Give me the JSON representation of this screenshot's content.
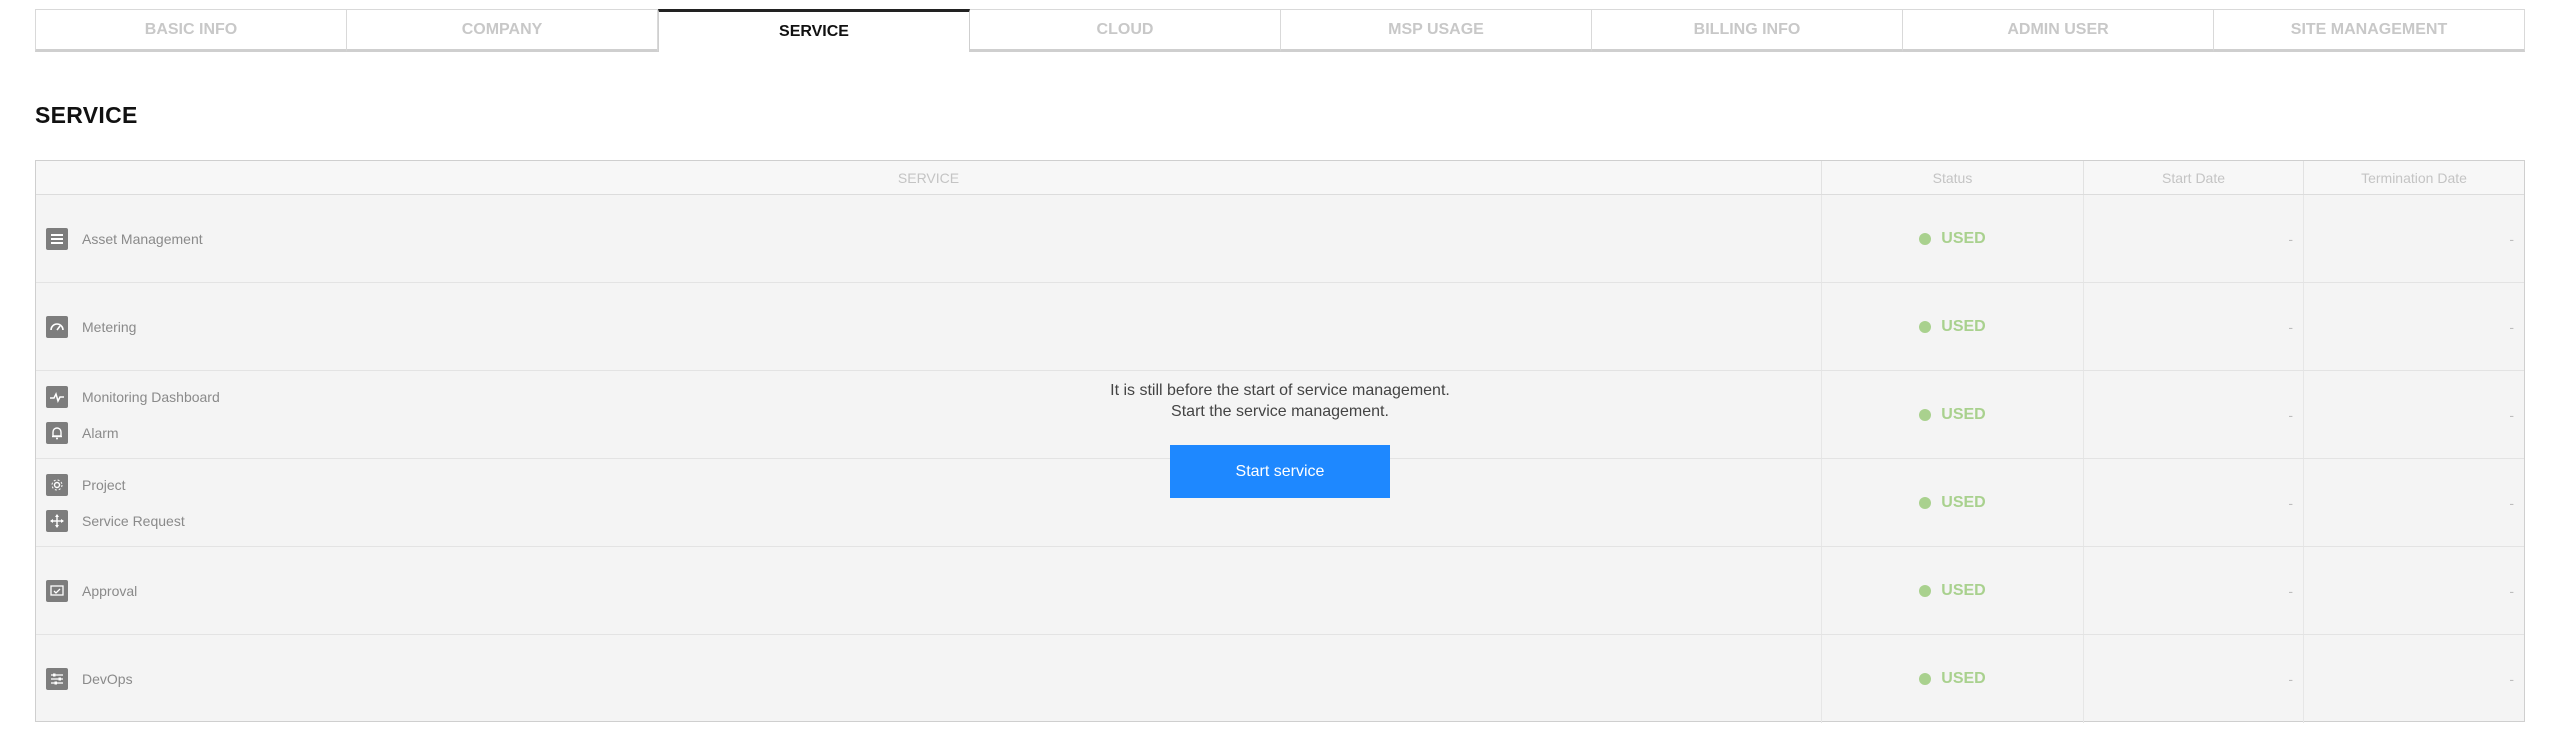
{
  "tabs": [
    {
      "label": "BASIC INFO",
      "active": false
    },
    {
      "label": "COMPANY",
      "active": false
    },
    {
      "label": "SERVICE",
      "active": true
    },
    {
      "label": "CLOUD",
      "active": false
    },
    {
      "label": "MSP USAGE",
      "active": false
    },
    {
      "label": "BILLING INFO",
      "active": false
    },
    {
      "label": "ADMIN USER",
      "active": false
    },
    {
      "label": "SITE MANAGEMENT",
      "active": false
    }
  ],
  "section_title": "SERVICE",
  "table": {
    "headers": {
      "service": "SERVICE",
      "status": "Status",
      "start_date": "Start Date",
      "termination_date": "Termination Date"
    },
    "rows": [
      {
        "services": [
          {
            "label": "Asset Management",
            "icon": "list-icon"
          }
        ],
        "status": "USED",
        "start": "-",
        "end": "-"
      },
      {
        "services": [
          {
            "label": "Metering",
            "icon": "gauge-icon"
          }
        ],
        "status": "USED",
        "start": "-",
        "end": "-"
      },
      {
        "services": [
          {
            "label": "Monitoring Dashboard",
            "icon": "pulse-icon"
          },
          {
            "label": "Alarm",
            "icon": "bell-icon"
          }
        ],
        "status": "USED",
        "start": "-",
        "end": "-"
      },
      {
        "services": [
          {
            "label": "Project",
            "icon": "gear-icon"
          },
          {
            "label": "Service Request",
            "icon": "move-icon"
          }
        ],
        "status": "USED",
        "start": "-",
        "end": "-"
      },
      {
        "services": [
          {
            "label": "Approval",
            "icon": "approval-icon"
          }
        ],
        "status": "USED",
        "start": "-",
        "end": "-"
      },
      {
        "services": [
          {
            "label": "DevOps",
            "icon": "sliders-icon"
          }
        ],
        "status": "USED",
        "start": "-",
        "end": "-"
      }
    ]
  },
  "overlay": {
    "line1": "It is still before the start of service management.",
    "line2": "Start the service management.",
    "button_label": "Start service"
  },
  "colors": {
    "accent": "#1e88ff",
    "status_used": "#a9d18e",
    "active_tab_border": "#222222"
  }
}
